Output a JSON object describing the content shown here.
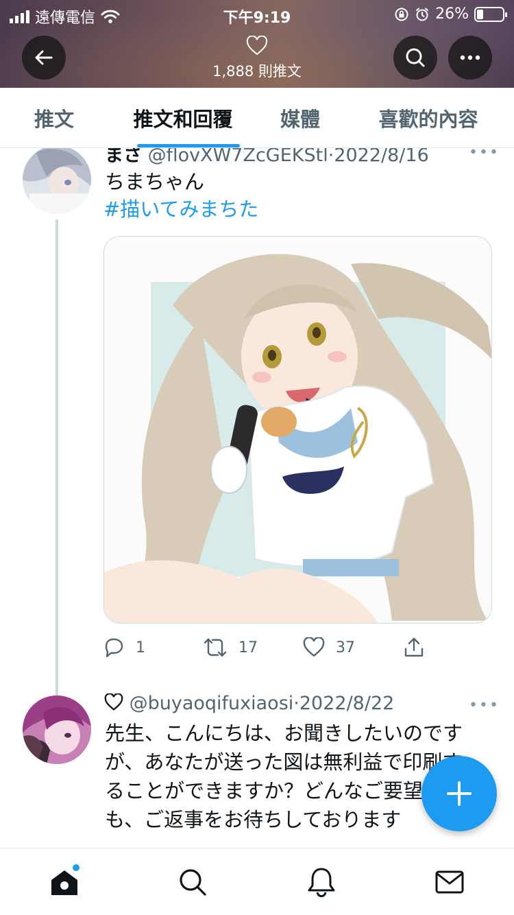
{
  "status_bar": {
    "carrier": "遠傳電信",
    "time": "下午9:19",
    "battery": "26%",
    "battery_level": 0.26
  },
  "header": {
    "tweet_count": "1,888 則推文",
    "icons": {
      "back": "back-arrow-icon",
      "profile": "heart-icon",
      "search": "search-icon",
      "more": "more-icon"
    }
  },
  "tabs": [
    {
      "label": "推文",
      "active": false
    },
    {
      "label": "推文和回覆",
      "active": true
    },
    {
      "label": "媒體",
      "active": false
    },
    {
      "label": "喜歡的內容",
      "active": false
    }
  ],
  "tweets": [
    {
      "name": "まさ",
      "handle": "@flovXW7ZcGEKStl",
      "date": "2022/8/16",
      "text": "ちまちゃん",
      "hashtag": "#描いてみまちた",
      "reply_count": "1",
      "retweet_count": "17",
      "like_count": "37"
    },
    {
      "name_icon": "heart-outline-icon",
      "handle": "@buyaoqifuxiaosi",
      "date": "2022/8/22",
      "text_lines": [
        "先生、こんにちは、お聞きしたいのです",
        "が、あなたが送った図は無利益で印刷す",
        "ることができますか？どんなご要望で",
        "も、ご返事をお待ちしております"
      ]
    }
  ],
  "colors": {
    "accent": "#1d9bf0",
    "text": "#0f1419",
    "muted": "#536471"
  },
  "bottom_nav": [
    "home-icon",
    "search-icon",
    "bell-icon",
    "mail-icon"
  ]
}
